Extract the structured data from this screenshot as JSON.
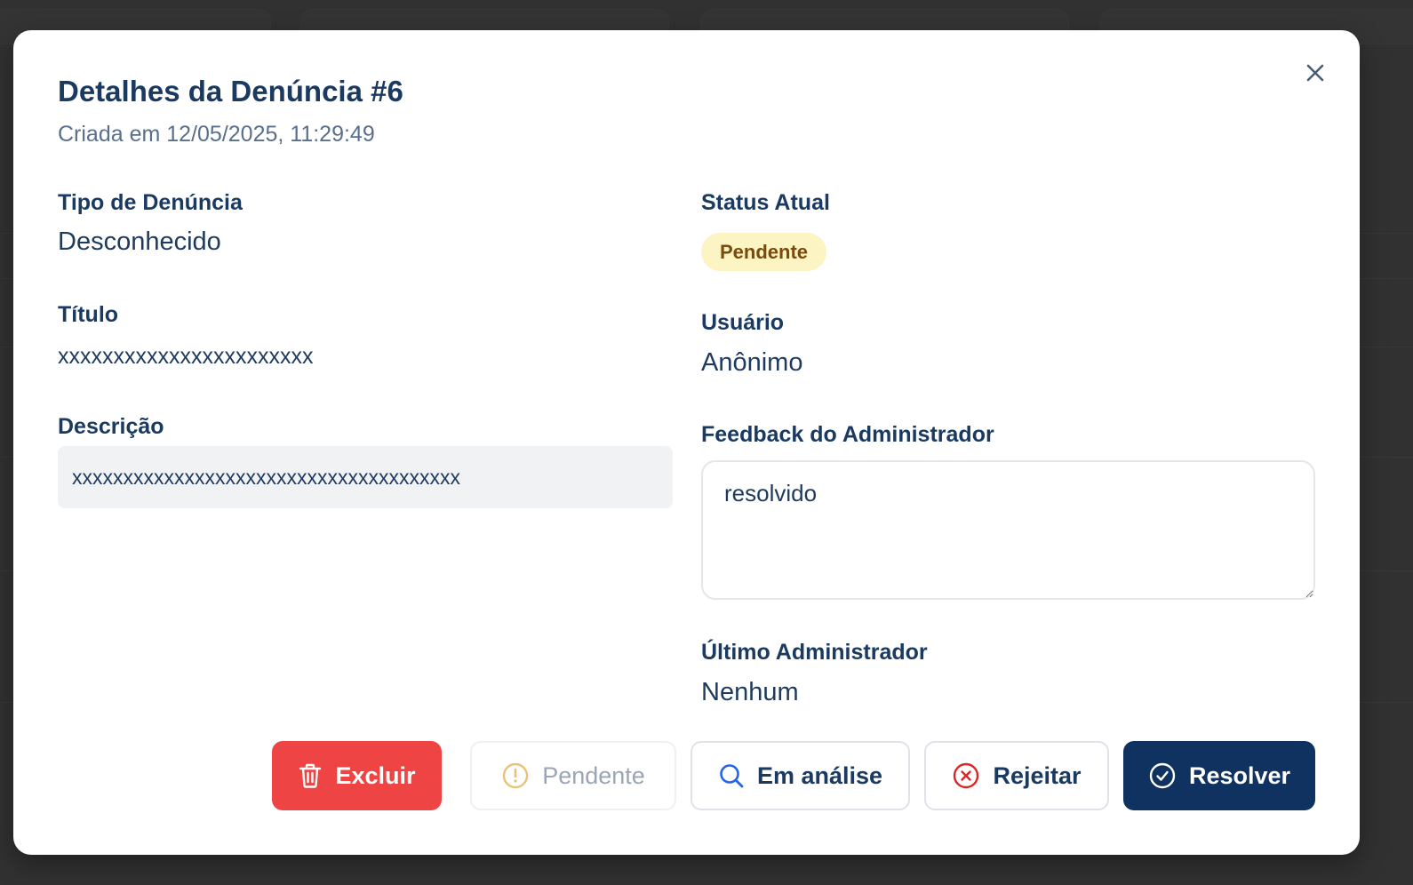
{
  "modal": {
    "title": "Detalhes da Denúncia #6",
    "subtitle": "Criada em 12/05/2025, 11:29:49",
    "close_icon": "close-icon"
  },
  "fields": {
    "tipo_label": "Tipo de Denúncia",
    "tipo_value": "Desconhecido",
    "titulo_label": "Título",
    "titulo_value": "xxxxxxxxxxxxxxxxxxxxxxx",
    "descricao_label": "Descrição",
    "descricao_value": "xxxxxxxxxxxxxxxxxxxxxxxxxxxxxxxxxxxxxx",
    "status_label": "Status Atual",
    "status_value": "Pendente",
    "usuario_label": "Usuário",
    "usuario_value": "Anônimo",
    "feedback_label": "Feedback do Administrador",
    "feedback_value": "resolvido",
    "ultimo_admin_label": "Último Administrador",
    "ultimo_admin_value": "Nenhum"
  },
  "actions": {
    "delete_label": "Excluir",
    "pending_label": "Pendente",
    "analysis_label": "Em análise",
    "reject_label": "Rejeitar",
    "resolve_label": "Resolver"
  },
  "colors": {
    "delete": "#ef4444",
    "resolve": "#0f3260",
    "status_badge_bg": "#fdf4c3",
    "status_badge_text": "#7a4a0c",
    "heading": "#1a3a62"
  }
}
